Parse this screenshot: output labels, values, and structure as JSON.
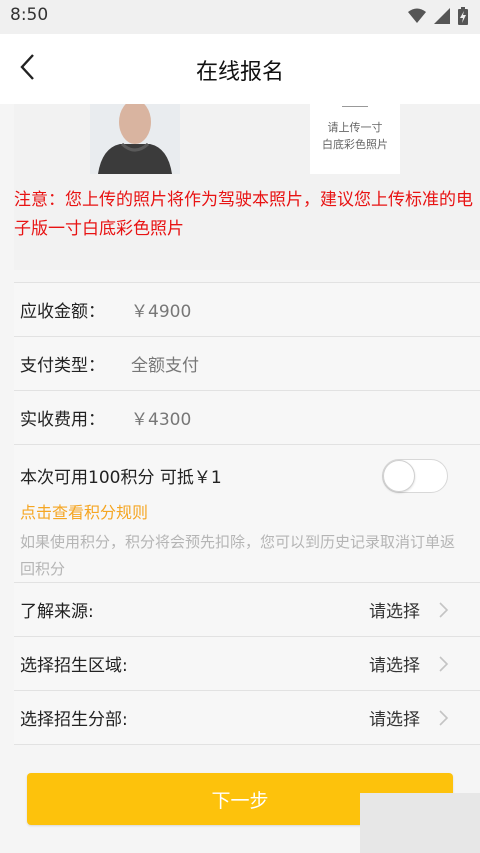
{
  "status_bar": {
    "time": "8:50",
    "icons": [
      "wifi-icon",
      "signal-icon",
      "battery-charging-icon"
    ]
  },
  "header": {
    "title": "在线报名",
    "back_icon": "chevron-left-icon"
  },
  "photo": {
    "upload_text_line1": "请上传一寸",
    "upload_text_line2": "白底彩色照片"
  },
  "notice": "注意：您上传的照片将作为驾驶本照片，建议您上传标准的电子版一寸白底彩色照片",
  "fees": [
    {
      "label": "应收金额：",
      "value": "￥4900"
    },
    {
      "label": "支付类型：",
      "value": "全额支付"
    },
    {
      "label": "实收费用：",
      "value": "￥4300"
    }
  ],
  "points": {
    "text": "本次可用100积分   可抵￥1",
    "toggle_on": false,
    "rules_link": "点击查看积分规则",
    "note": "如果使用积分，积分将会预先扣除，您可以到历史记录取消订单返回积分"
  },
  "selects": [
    {
      "label": "了解来源:",
      "value": "请选择"
    },
    {
      "label": "选择招生区域:",
      "value": "请选择"
    },
    {
      "label": "选择招生分部:",
      "value": "请选择"
    }
  ],
  "next_button": "下一步",
  "colors": {
    "accent": "#fdc20c",
    "notice": "#e81313",
    "link": "#f5a623"
  }
}
